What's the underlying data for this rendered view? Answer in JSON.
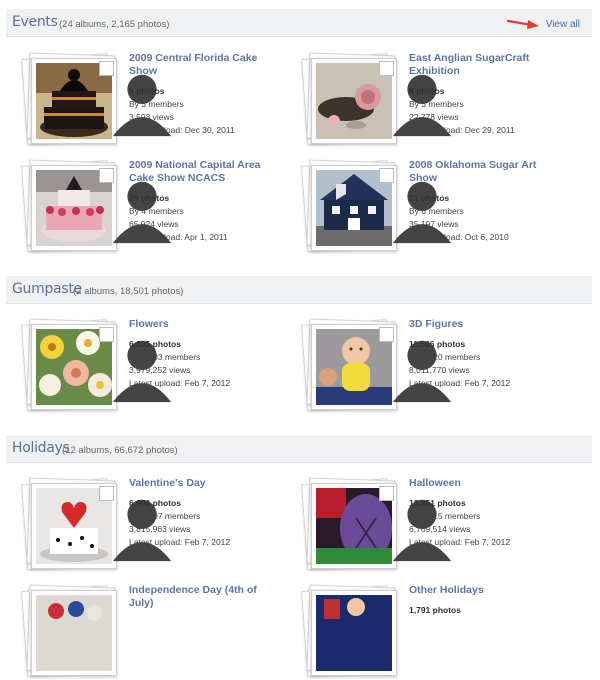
{
  "sections": [
    {
      "title": "Events",
      "subtitle": "(24 albums, 2,165 photos)",
      "view_all": "View all",
      "albums": [
        {
          "title": "2009 Central Florida Cake Show",
          "photos": "3 photos",
          "members": "By 3 members",
          "views": "3,593 views",
          "latest": "Latest upload: Dec 30, 2011"
        },
        {
          "title": "East Anglian SugarCraft Exhibition",
          "photos": "8 photos",
          "members": "By 3 members",
          "views": "22,778 views",
          "latest": "Latest upload: Dec 29, 2011"
        },
        {
          "title": "2009 National Capital Area Cake Show NCACS",
          "photos": "29 photos",
          "members": "By 4 members",
          "views": "65,924 views",
          "latest": "Latest upload: Apr 1, 2011"
        },
        {
          "title": "2008 Oklahoma Sugar Art Show",
          "photos": "21 photos",
          "members": "By 6 members",
          "views": "35,197 views",
          "latest": "Latest upload: Oct 6, 2010"
        }
      ]
    },
    {
      "title": "Gumpaste",
      "subtitle": "(2 albums, 18,501 photos)",
      "albums": [
        {
          "title": "Flowers",
          "photos": "6,835 photos",
          "members": "By 2,403 members",
          "views": "3,979,252 views",
          "latest": "Latest upload: Feb 7, 2012"
        },
        {
          "title": "3D Figures",
          "photos": "11,666 photos",
          "members": "By 3,220 members",
          "views": "8,011,770 views",
          "latest": "Latest upload: Feb 7, 2012"
        }
      ]
    },
    {
      "title": "Holidays",
      "subtitle": "(12 albums, 66,672 photos)",
      "albums": [
        {
          "title": "Valentine's Day",
          "photos": "6,906 photos",
          "members": "By 3,607 members",
          "views": "3,815,963 views",
          "latest": "Latest upload: Feb 7, 2012"
        },
        {
          "title": "Halloween",
          "photos": "13,451 photos",
          "members": "By 6,315 members",
          "views": "6,769,514 views",
          "latest": "Latest upload: Feb 7, 2012"
        },
        {
          "title": "Independence Day (4th of July)",
          "photos": "",
          "members": "",
          "views": "",
          "latest": ""
        },
        {
          "title": "Other Holidays",
          "photos": "1,791 photos",
          "members": "",
          "views": "",
          "latest": ""
        }
      ]
    }
  ],
  "colors": {
    "link": "#5d74a6",
    "header_bg": "#f0f1f3",
    "arrow": "#e23a2e"
  }
}
